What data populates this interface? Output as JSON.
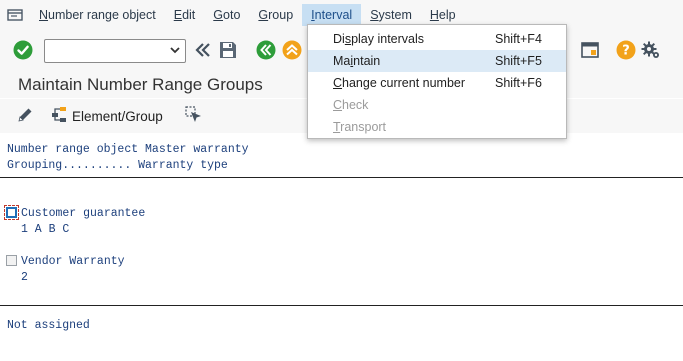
{
  "menubar": {
    "items": [
      {
        "prefix": "",
        "mnemonic": "N",
        "rest": "umber range object"
      },
      {
        "prefix": "",
        "mnemonic": "E",
        "rest": "dit"
      },
      {
        "prefix": "",
        "mnemonic": "G",
        "rest": "oto"
      },
      {
        "prefix": "",
        "mnemonic": "G",
        "rest": "roup"
      },
      {
        "prefix": "",
        "mnemonic": "I",
        "rest": "nterval"
      },
      {
        "prefix": "",
        "mnemonic": "S",
        "rest": "ystem"
      },
      {
        "prefix": "",
        "mnemonic": "H",
        "rest": "elp"
      }
    ]
  },
  "toolbar": {
    "command_value": "",
    "icons": [
      "enter-icon",
      "back-fast-icon",
      "save-icon",
      "back-icon",
      "exit-icon",
      "layout-icon",
      "help-icon",
      "settings-icon"
    ]
  },
  "page": {
    "title": "Maintain Number Range Groups"
  },
  "app_toolbar": {
    "element_group_label": "Element/Group"
  },
  "content": {
    "object_line": "Number range object Master warranty",
    "grouping_line": "Grouping.......... Warranty type",
    "groups": [
      {
        "name": "Customer guarantee",
        "elements": "1 A B C",
        "selected": true
      },
      {
        "name": "Vendor Warranty",
        "elements": "2",
        "selected": false
      }
    ],
    "not_assigned": "Not assigned"
  },
  "interval_menu": {
    "items": [
      {
        "before": "Di",
        "mnemonic": "s",
        "after": "play intervals",
        "shortcut": "Shift+F4",
        "enabled": true,
        "highlighted": false
      },
      {
        "before": "Ma",
        "mnemonic": "i",
        "after": "ntain",
        "shortcut": "Shift+F5",
        "enabled": true,
        "highlighted": true
      },
      {
        "before": "",
        "mnemonic": "C",
        "after": "hange current number",
        "shortcut": "Shift+F6",
        "enabled": true,
        "highlighted": false
      },
      {
        "before": "",
        "mnemonic": "C",
        "after": "heck",
        "shortcut": "",
        "enabled": false,
        "highlighted": false
      },
      {
        "before": "",
        "mnemonic": "T",
        "after": "ransport",
        "shortcut": "",
        "enabled": false,
        "highlighted": false
      }
    ]
  },
  "colors": {
    "accent_blue": "#1f6fb8",
    "enter_green": "#2e9d3a",
    "exit_orange": "#f2a21a",
    "content_text": "#1c3f7c"
  }
}
